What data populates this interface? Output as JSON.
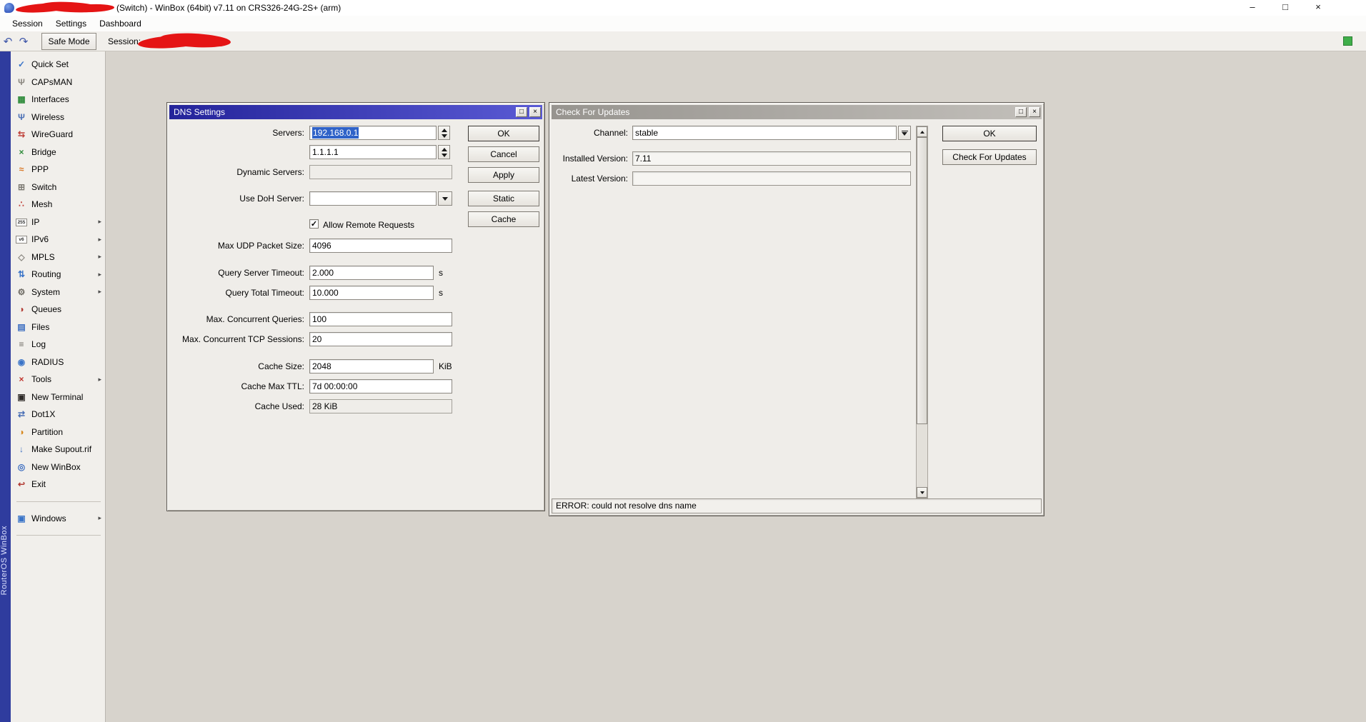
{
  "titlebar": {
    "title": "(Switch) - WinBox (64bit) v7.11 on CRS326-24G-2S+ (arm)",
    "minimize": "–",
    "maximize": "□",
    "close": "×"
  },
  "menubar": {
    "items": [
      {
        "label": "Session"
      },
      {
        "label": "Settings"
      },
      {
        "label": "Dashboard"
      }
    ]
  },
  "toolbar": {
    "undo": "↶",
    "redo": "↷",
    "safe_mode": "Safe Mode",
    "session_label": "Session:"
  },
  "sidebar": {
    "brand": "RouterOS WinBox",
    "items": [
      {
        "label": "Quick Set",
        "glyph": "✓",
        "icon_style": "color:#3a74c8",
        "arrow": ""
      },
      {
        "label": "CAPsMAN",
        "glyph": "Ψ",
        "icon_style": "color:#8a8780",
        "arrow": ""
      },
      {
        "label": "Interfaces",
        "glyph": "▦",
        "icon_style": "color:#2e8b3a",
        "arrow": ""
      },
      {
        "label": "Wireless",
        "glyph": "Ψ",
        "icon_style": "color:#4a6fb5",
        "arrow": ""
      },
      {
        "label": "WireGuard",
        "glyph": "⇆",
        "icon_style": "color:#c0443c",
        "arrow": ""
      },
      {
        "label": "Bridge",
        "glyph": "×",
        "icon_style": "color:#2e8b3a",
        "arrow": ""
      },
      {
        "label": "PPP",
        "glyph": "≈",
        "icon_style": "color:#d8731e",
        "arrow": ""
      },
      {
        "label": "Switch",
        "glyph": "⊞",
        "icon_style": "color:#7c7972",
        "arrow": ""
      },
      {
        "label": "Mesh",
        "glyph": "∴",
        "icon_style": "color:#c0443c",
        "arrow": ""
      },
      {
        "label": "IP",
        "glyph": "255",
        "icon_style": "color:#333333",
        "arrow": "▸"
      },
      {
        "label": "IPv6",
        "glyph": "v6",
        "icon_style": "color:#333333",
        "arrow": "▸"
      },
      {
        "label": "MPLS",
        "glyph": "◇",
        "icon_style": "color:#8a8780",
        "arrow": "▸"
      },
      {
        "label": "Routing",
        "glyph": "⇅",
        "icon_style": "color:#3a74c8",
        "arrow": "▸"
      },
      {
        "label": "System",
        "glyph": "⚙",
        "icon_style": "color:#6e6b64",
        "arrow": "▸"
      },
      {
        "label": "Queues",
        "glyph": "◑",
        "icon_style": "color:#b23c34",
        "arrow": ""
      },
      {
        "label": "Files",
        "glyph": "▤",
        "icon_style": "color:#3a6cc0",
        "arrow": ""
      },
      {
        "label": "Log",
        "glyph": "≡",
        "icon_style": "color:#6e6b64",
        "arrow": ""
      },
      {
        "label": "RADIUS",
        "glyph": "◉",
        "icon_style": "color:#3a74c8",
        "arrow": ""
      },
      {
        "label": "Tools",
        "glyph": "×",
        "icon_style": "color:#c0342c",
        "arrow": "▸"
      },
      {
        "label": "New Terminal",
        "glyph": "▣",
        "icon_style": "color:#2e2b28",
        "arrow": ""
      },
      {
        "label": "Dot1X",
        "glyph": "⇄",
        "icon_style": "color:#4a6fb5",
        "arrow": ""
      },
      {
        "label": "Partition",
        "glyph": "◑",
        "icon_style": "color:#d8881e",
        "arrow": ""
      },
      {
        "label": "Make Supout.rif",
        "glyph": "↓",
        "icon_style": "color:#3a6cc0",
        "arrow": ""
      },
      {
        "label": "New WinBox",
        "glyph": "◎",
        "icon_style": "color:#3a6cc0",
        "arrow": ""
      },
      {
        "label": "Exit",
        "glyph": "↩",
        "icon_style": "color:#b23c34",
        "arrow": ""
      },
      {
        "label": "Windows",
        "glyph": "▣",
        "icon_style": "color:#3a74c8",
        "arrow": "▸"
      }
    ]
  },
  "dns": {
    "title": "DNS Settings",
    "restore": "□",
    "close": "×",
    "servers_label": "Servers:",
    "servers_value": "192.168.0.1",
    "servers2_value": "1.1.1.1",
    "dynamic_label": "Dynamic Servers:",
    "dynamic_value": "",
    "doh_label": "Use DoH Server:",
    "doh_value": "",
    "allow_remote_label": "Allow Remote Requests",
    "allow_remote_checked": "✓",
    "max_udp_label": "Max UDP Packet Size:",
    "max_udp_value": "4096",
    "query_server_label": "Query Server Timeout:",
    "query_server_value": "2.000",
    "query_server_suffix": "s",
    "query_total_label": "Query Total Timeout:",
    "query_total_value": "10.000",
    "query_total_suffix": "s",
    "max_queries_label": "Max. Concurrent Queries:",
    "max_queries_value": "100",
    "max_tcp_label": "Max. Concurrent TCP Sessions:",
    "max_tcp_value": "20",
    "cache_size_label": "Cache Size:",
    "cache_size_value": "2048",
    "cache_size_suffix": "KiB",
    "cache_ttl_label": "Cache Max TTL:",
    "cache_ttl_value": "7d 00:00:00",
    "cache_used_label": "Cache Used:",
    "cache_used_value": "28 KiB",
    "ok": "OK",
    "cancel": "Cancel",
    "apply": "Apply",
    "static": "Static",
    "cache": "Cache"
  },
  "updates": {
    "title": "Check For Updates",
    "restore": "□",
    "close": "×",
    "channel_label": "Channel:",
    "channel_value": "stable",
    "installed_label": "Installed Version:",
    "installed_value": "7.11",
    "latest_label": "Latest Version:",
    "latest_value": "",
    "ok": "OK",
    "check": "Check For Updates",
    "status": "ERROR: could not resolve dns name"
  },
  "colors": {
    "titlebar_active_from": "#24249a",
    "titlebar_active_to": "#5a5ad4",
    "titlebar_inactive": "#97948f",
    "selection": "#2f62c8",
    "redaction": "#e51414",
    "status_green": "#3fae49",
    "sidebar_strip": "#2f3c9e"
  }
}
